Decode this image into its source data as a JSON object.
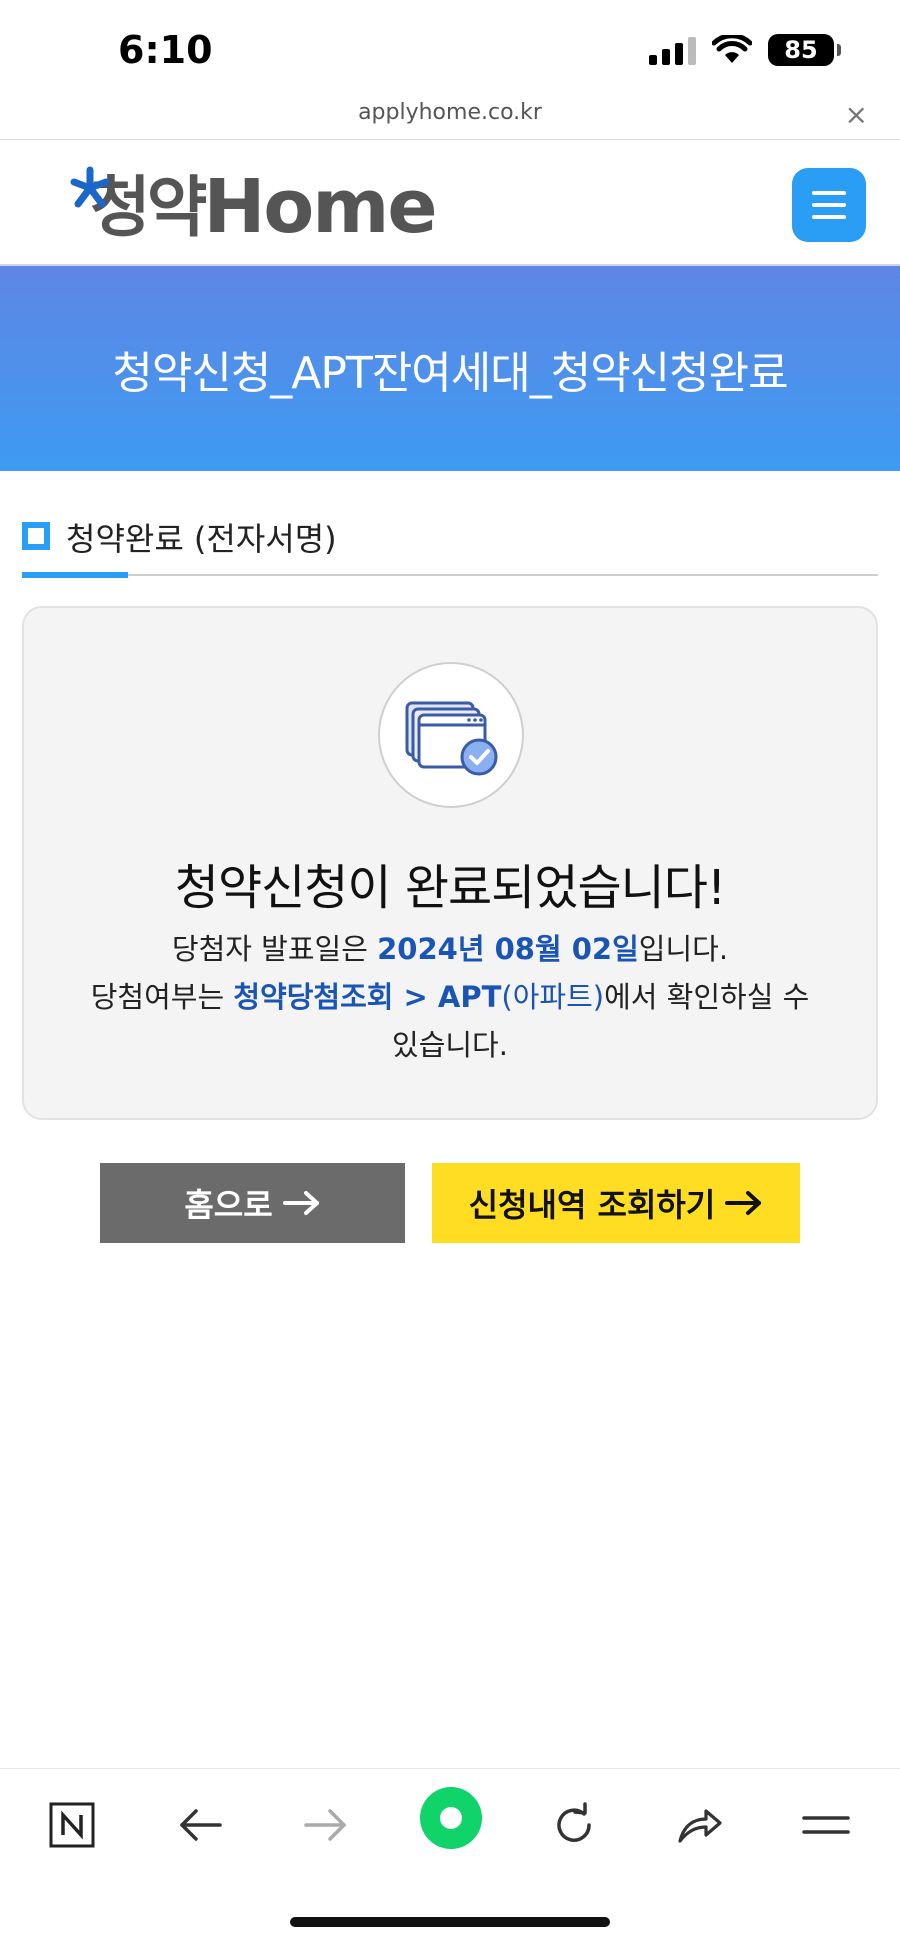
{
  "status_bar": {
    "time": "6:10",
    "battery": "85",
    "icons": [
      "signal-icon",
      "wifi-icon",
      "battery-icon"
    ]
  },
  "url_bar": {
    "url": "applyhome.co.kr",
    "close": "×"
  },
  "header": {
    "logo_ko": "청약",
    "logo_en": "Home",
    "menu_icon": "hamburger-icon"
  },
  "banner": {
    "title": "청약신청_APT잔여세대_청약신청완료"
  },
  "section": {
    "title": "청약완료 (전자서명)"
  },
  "card": {
    "icon": "document-check-icon",
    "title": "청약신청이 완료되었습니다!",
    "line1_prefix": "당첨자 발표일은 ",
    "line1_date": "2024년 08월 02일",
    "line1_suffix": "입니다.",
    "line2_prefix": "당첨여부는 ",
    "line2_link_bold": "청약당첨조회 > APT",
    "line2_link_normal": "(아파트)",
    "line2_suffix": "에서 확인하실 수",
    "line3": "있습니다."
  },
  "buttons": {
    "home": "홈으로",
    "inquiry": "신청내역 조회하기"
  },
  "colors": {
    "accent": "#2a9df4",
    "banner_top": "#5f86e6",
    "banner_bottom": "#3d9bf0",
    "highlight": "#1a55b5",
    "home_button": "#6b6b6b",
    "inquiry_button": "#ffdd22",
    "browser_green": "#10d36a"
  },
  "toolbar": {
    "icons": [
      "naver-n-icon",
      "back-arrow-icon",
      "forward-arrow-icon",
      "green-dot-icon",
      "reload-icon",
      "share-icon",
      "menu-lines-icon"
    ]
  }
}
